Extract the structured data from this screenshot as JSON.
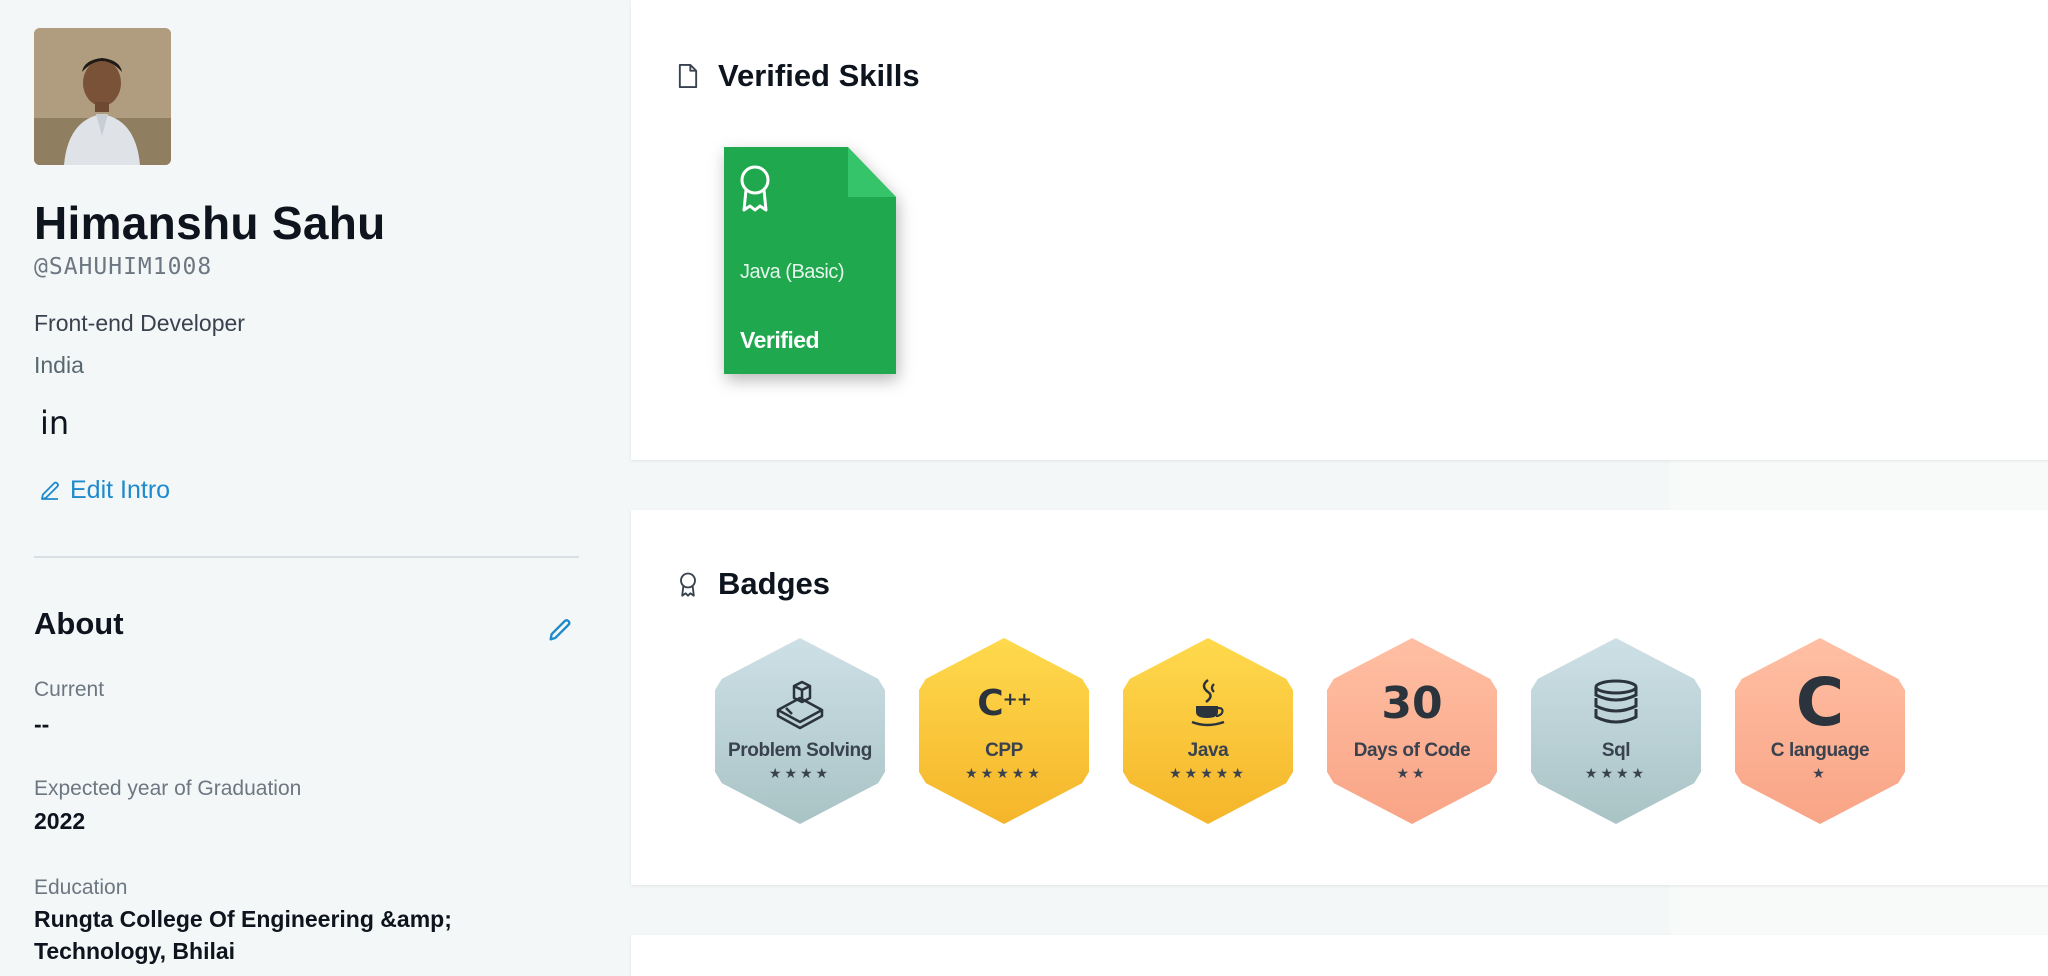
{
  "profile": {
    "name": "Himanshu Sahu",
    "handle": "@SAHUHIM1008",
    "role": "Front-end Developer",
    "country": "India",
    "linkedin_glyph": "in",
    "edit_intro_label": "Edit Intro"
  },
  "about": {
    "title": "About",
    "fields": [
      {
        "label": "Current",
        "value": "--"
      },
      {
        "label": "Expected year of Graduation",
        "value": "2022"
      },
      {
        "label": "Education",
        "value_line1": "Rungta College Of Engineering &amp;",
        "value_line2": "Technology, Bhilai"
      }
    ]
  },
  "skills": {
    "title": "Verified Skills",
    "items": [
      {
        "name": "Java (Basic)",
        "status": "Verified",
        "color": "#1fa84e"
      }
    ]
  },
  "badges": {
    "title": "Badges",
    "items": [
      {
        "name": "Problem Solving",
        "stars": "★★★★",
        "tier": "silver",
        "icon": "cube-tool-icon"
      },
      {
        "name": "CPP",
        "stars": "★★★★★",
        "tier": "gold",
        "icon": "cpp-icon",
        "glyph": "C++"
      },
      {
        "name": "Java",
        "stars": "★★★★★",
        "tier": "gold",
        "icon": "java-cup-icon"
      },
      {
        "name": "Days of Code",
        "stars": "★★",
        "tier": "bronze",
        "icon": "number-icon",
        "glyph": "30"
      },
      {
        "name": "Sql",
        "stars": "★★★★",
        "tier": "silver",
        "icon": "database-icon"
      },
      {
        "name": "C language",
        "stars": "★",
        "tier": "bronze",
        "icon": "c-letter-icon",
        "glyph": "C"
      }
    ]
  },
  "colors": {
    "accent": "#1f8acb",
    "verified_green": "#1fa84e",
    "gold": "#f5b52a",
    "silver": "#a9c3c5",
    "bronze": "#f9a486"
  }
}
